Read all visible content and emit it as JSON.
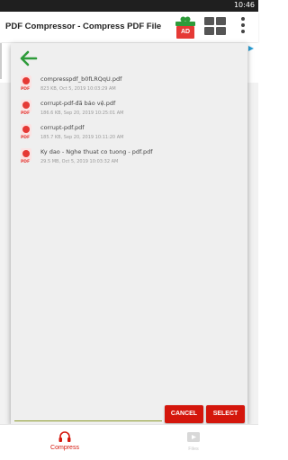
{
  "status_bar": {
    "time": "10:46"
  },
  "app_bar": {
    "title": "PDF Compressor - Compress PDF File",
    "ad_label": "AD",
    "ad_icon": "gift-icon",
    "grid_icon": "grid-view-icon",
    "menu_icon": "more-vert-icon"
  },
  "dialog": {
    "back_icon": "arrow-back-icon",
    "accent_color": "#2e9b3a",
    "files": [
      {
        "name": "compresspdf_b0fLRQqU.pdf",
        "meta": "823 KB, Oct 5, 2019 10:03:29 AM"
      },
      {
        "name": "corrupt-pdf-đã bảo vệ.pdf",
        "meta": "186.6 KB, Sep 20, 2019 10:25:01 AM"
      },
      {
        "name": "corrupt-pdf.pdf",
        "meta": "185.7 KB, Sep 20, 2019 10:11:20 AM"
      },
      {
        "name": "Ky dao - Nghe thuat co tuong - pdf.pdf",
        "meta": "29.5 MB, Oct 5, 2019 10:03:32 AM"
      }
    ],
    "cancel_label": "CANCEL",
    "select_label": "SELECT",
    "button_color": "#d4160c"
  },
  "bottom_nav": {
    "compress_label": "Compress",
    "files_label": "Files",
    "compress_icon": "compress-icon",
    "files_icon": "files-icon",
    "active_color": "#d4160c"
  }
}
